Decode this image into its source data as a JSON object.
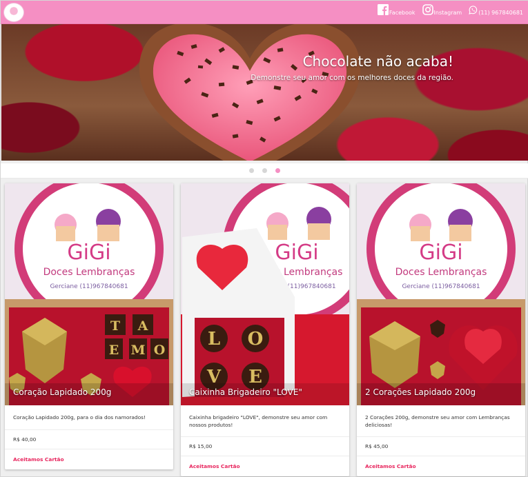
{
  "colors": {
    "brand_pink": "#f58fc3",
    "action_red": "#e8265e"
  },
  "nav": {
    "logo_icon": "gigi-doces-logo",
    "links": [
      {
        "label": "Facebook",
        "icon": "facebook-icon"
      },
      {
        "label": "Instagram",
        "icon": "instagram-icon"
      },
      {
        "label": "(11) 967840681",
        "icon": "whatsapp-icon"
      }
    ]
  },
  "carousel": {
    "title": "Chocolate não acaba!",
    "subtitle": "Demonstre seu amor com os melhores doces da região.",
    "slide_count": 3,
    "active_index": 2
  },
  "card_image_text": {
    "brand": "GiGi",
    "brand_sub": "Doces Lembranças",
    "phone_line": "Gerciane (11)967840681",
    "letters_ta": [
      "T",
      "A"
    ],
    "letters_emo": [
      "E",
      "M",
      "O"
    ],
    "letters_lo": [
      "L",
      "O"
    ],
    "letters_ve": [
      "V",
      "E"
    ]
  },
  "products": [
    {
      "title": "Coração Lapidado 200g",
      "description": "Coração Lapidado 200g, para o dia dos namorados!",
      "price": "R$ 40,00",
      "action": "Aceitamos Cartão"
    },
    {
      "title": "Caixinha Brigadeiro \"LOVE\"",
      "description": "Caixinha brigadeiro \"LOVE\", demonstre seu amor com nossos produtos!",
      "price": "R$ 15,00",
      "action": "Aceitamos Cartão"
    },
    {
      "title": "2 Corações Lapidado 200g",
      "description": "2 Corações 200g, demonstre seu amor com Lembranças deliciosas!",
      "price": "R$ 45,00",
      "action": "Aceitamos Cartão"
    }
  ]
}
